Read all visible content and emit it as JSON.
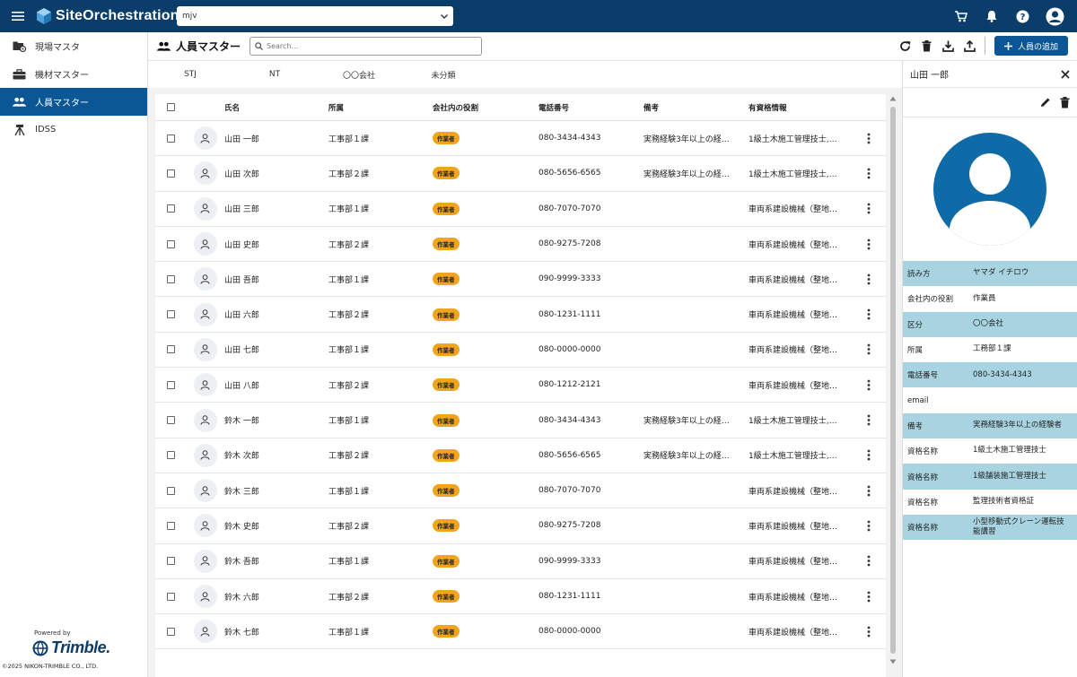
{
  "app": {
    "title": "SiteOrchestration",
    "project": "mjv"
  },
  "sidebar": {
    "items": [
      {
        "label": "現場マスタ",
        "icon": "folder-gear-icon"
      },
      {
        "label": "機材マスター",
        "icon": "toolbox-icon"
      },
      {
        "label": "人員マスター",
        "icon": "people-icon"
      },
      {
        "label": "IDSS",
        "icon": "survey-tripod-icon"
      }
    ],
    "powered_by": "Powered by",
    "brand": "Trimble.",
    "copyright": "©2025 NIKON-TRIMBLE CO., LTD."
  },
  "header": {
    "title": "人員マスター",
    "search_placeholder": "Search...",
    "add_label": "人員の追加"
  },
  "tabs": [
    "STJ",
    "NT",
    "〇〇会社",
    "未分類"
  ],
  "columns": {
    "name": "氏名",
    "dept": "所属",
    "role": "会社内の役割",
    "tel": "電話番号",
    "note": "備考",
    "qual": "有資格情報"
  },
  "rows": [
    {
      "name": "山田 一郎",
      "dept": "工事部１課",
      "role": "作業者",
      "tel": "080-3434-4343",
      "note": "実務経験3年以上の経…",
      "qual": "1級土木施工管理技士,…"
    },
    {
      "name": "山田 次郎",
      "dept": "工事部２課",
      "role": "作業者",
      "tel": "080-5656-6565",
      "note": "実務経験3年以上の経…",
      "qual": "1級土木施工管理技士,…"
    },
    {
      "name": "山田 三郎",
      "dept": "工事部１課",
      "role": "作業者",
      "tel": "080-7070-7070",
      "note": "",
      "qual": "車両系建設機械（整地…"
    },
    {
      "name": "山田 史郎",
      "dept": "工事部２課",
      "role": "作業者",
      "tel": "080-9275-7208",
      "note": "",
      "qual": "車両系建設機械（整地…"
    },
    {
      "name": "山田 吾郎",
      "dept": "工事部１課",
      "role": "作業者",
      "tel": "090-9999-3333",
      "note": "",
      "qual": "車両系建設機械（整地…"
    },
    {
      "name": "山田 六郎",
      "dept": "工事部２課",
      "role": "作業者",
      "tel": "080-1231-1111",
      "note": "",
      "qual": "車両系建設機械（整地…"
    },
    {
      "name": "山田 七郎",
      "dept": "工事部１課",
      "role": "作業者",
      "tel": "080-0000-0000",
      "note": "",
      "qual": "車両系建設機械（整地…"
    },
    {
      "name": "山田 八郎",
      "dept": "工事部２課",
      "role": "作業者",
      "tel": "080-1212-2121",
      "note": "",
      "qual": "車両系建設機械（整地…"
    },
    {
      "name": "鈴木 一郎",
      "dept": "工事部１課",
      "role": "作業者",
      "tel": "080-3434-4343",
      "note": "実務経験3年以上の経…",
      "qual": "1級土木施工管理技士,…"
    },
    {
      "name": "鈴木 次郎",
      "dept": "工事部２課",
      "role": "作業者",
      "tel": "080-5656-6565",
      "note": "実務経験3年以上の経…",
      "qual": "1級土木施工管理技士,…"
    },
    {
      "name": "鈴木 三郎",
      "dept": "工事部１課",
      "role": "作業者",
      "tel": "080-7070-7070",
      "note": "",
      "qual": "車両系建設機械（整地…"
    },
    {
      "name": "鈴木 史郎",
      "dept": "工事部２課",
      "role": "作業者",
      "tel": "080-9275-7208",
      "note": "",
      "qual": "車両系建設機械（整地…"
    },
    {
      "name": "鈴木 吾郎",
      "dept": "工事部１課",
      "role": "作業者",
      "tel": "090-9999-3333",
      "note": "",
      "qual": "車両系建設機械（整地…"
    },
    {
      "name": "鈴木 六郎",
      "dept": "工事部２課",
      "role": "作業者",
      "tel": "080-1231-1111",
      "note": "",
      "qual": "車両系建設機械（整地…"
    },
    {
      "name": "鈴木 七郎",
      "dept": "工事部１課",
      "role": "作業者",
      "tel": "080-0000-0000",
      "note": "",
      "qual": "車両系建設機械（整地…"
    }
  ],
  "detail": {
    "title": "山田 一郎",
    "fields": [
      {
        "label": "読み方",
        "value": "ヤマダ イチロウ"
      },
      {
        "label": "会社内の役割",
        "value": "作業員"
      },
      {
        "label": "区分",
        "value": "〇〇会社"
      },
      {
        "label": "所属",
        "value": "工務部１課"
      },
      {
        "label": "電話番号",
        "value": "080-3434-4343"
      },
      {
        "label": "email",
        "value": ""
      },
      {
        "label": "備考",
        "value": "実務経験3年以上の経験者"
      },
      {
        "label": "資格名称",
        "value": "1級土木施工管理技士"
      },
      {
        "label": "資格名称",
        "value": "1級舗装施工管理技士"
      },
      {
        "label": "資格名称",
        "value": "監理技術者資格証"
      },
      {
        "label": "資格名称",
        "value": "小型移動式クレーン運転技能講習"
      }
    ]
  },
  "colors": {
    "topbar": "#0b3d6b",
    "accent": "#0b5694",
    "badge": "#f2a51c",
    "detail_alt": "#a8d4e2"
  }
}
